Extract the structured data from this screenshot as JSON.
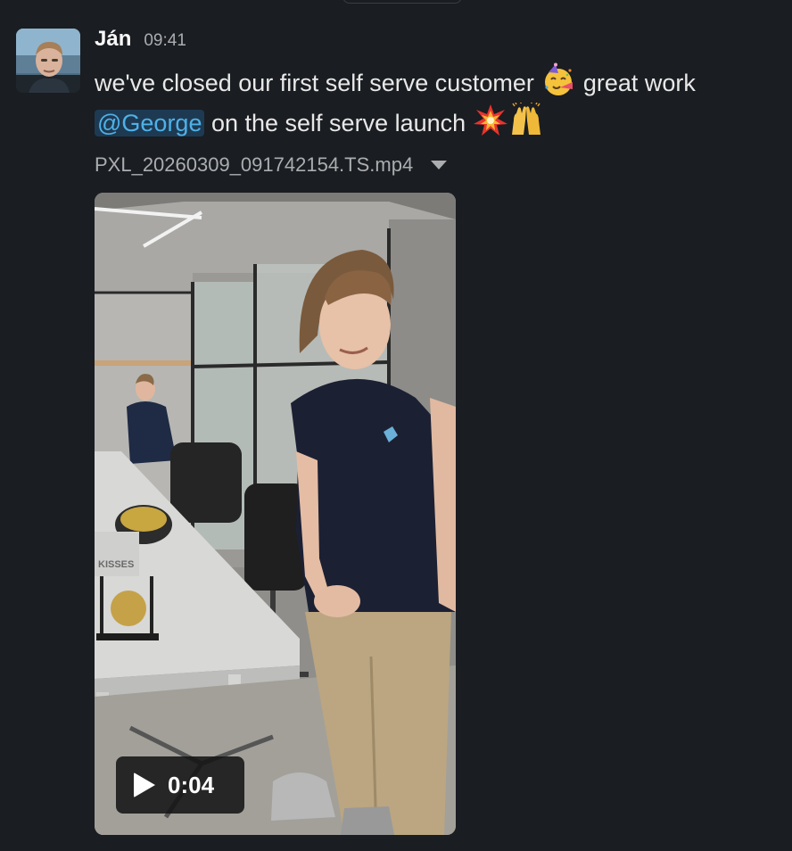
{
  "message": {
    "sender": "Ján",
    "timestamp": "09:41",
    "text_part1": "we've closed our first self serve customer",
    "emoji_1": "partying-face-emoji",
    "text_part2": " great work",
    "mention": "@George",
    "text_part3": " on the self serve launch ",
    "emoji_2": "collision-emoji",
    "emoji_3": "raising-hands-emoji"
  },
  "attachment": {
    "filename": "PXL_20260309_091742154.TS.mp4",
    "duration": "0:04",
    "sticker_text": "KISSES"
  },
  "colors": {
    "background": "#1a1d21",
    "mention_bg": "#1e3a52",
    "mention_text": "#4fb1e8"
  }
}
